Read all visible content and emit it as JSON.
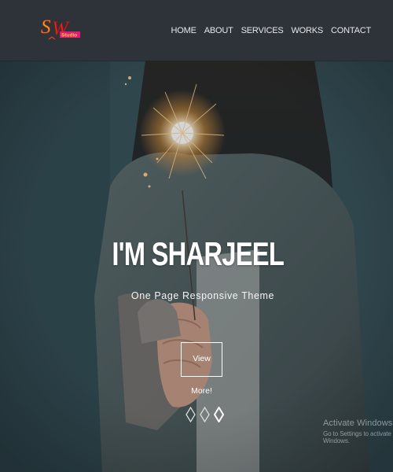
{
  "logo": {
    "text": "SW",
    "small_text": "Studio"
  },
  "nav": {
    "items": [
      {
        "label": "HOME"
      },
      {
        "label": "ABOUT"
      },
      {
        "label": "SERVICES"
      },
      {
        "label": "WORKS"
      },
      {
        "label": "CONTACT"
      }
    ]
  },
  "hero": {
    "title": "I'M SHARJEEL",
    "subtitle": "One Page Responsive Theme",
    "cta_label": "View More!",
    "slides_count": 3,
    "active_slide": 3
  },
  "watermark": {
    "title": "Activate Windows",
    "subtitle": "Go to Settings to activate Windows."
  },
  "colors": {
    "navbar": "#2d3339",
    "hero_teal": "#3d565d",
    "white": "#ffffff"
  }
}
